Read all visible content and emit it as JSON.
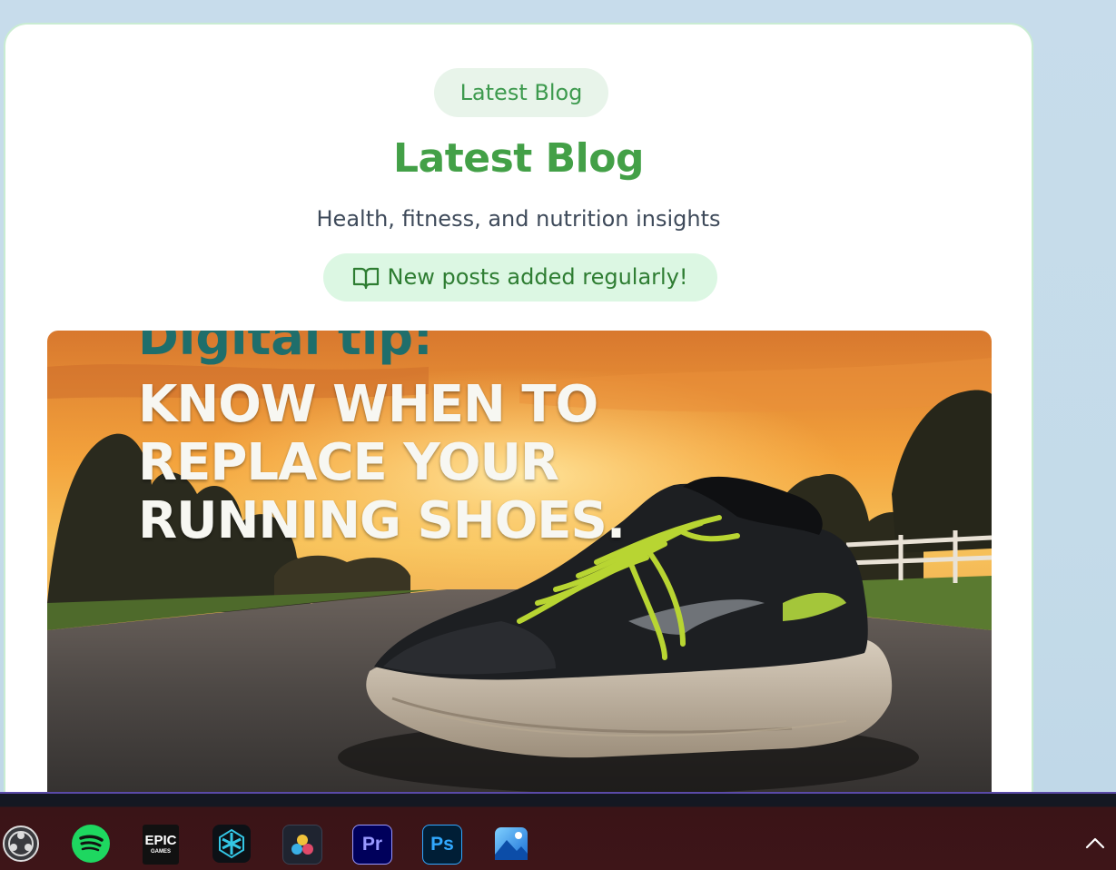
{
  "blog": {
    "badge_label": "Latest Blog",
    "heading": "Latest Blog",
    "subheading": "Health, fitness, and nutrition insights",
    "notice": "New posts added regularly!",
    "notice_icon": "book-open-icon"
  },
  "featured_post": {
    "image_caption_top": "Digital tip:",
    "image_lines": [
      "KNOW WHEN TO",
      "REPLACE YOUR",
      "RUNNING SHOES."
    ]
  },
  "taskbar": {
    "apps": [
      {
        "icon": "obs-icon"
      },
      {
        "icon": "spotify-icon"
      },
      {
        "icon": "epic-games-icon",
        "label": "EPIC",
        "sublabel": "GAMES"
      },
      {
        "icon": "app-blue-icon"
      },
      {
        "icon": "davinci-resolve-icon"
      },
      {
        "icon": "premiere-pro-icon",
        "label": "Pr"
      },
      {
        "icon": "photoshop-icon",
        "label": "Ps"
      },
      {
        "icon": "photos-icon"
      }
    ],
    "tray_icon": "chevron-up-icon"
  },
  "colors": {
    "accent": "#43a047",
    "pill_bg": "#e8f4ea",
    "notice_bg": "#dcf7e3",
    "taskbar_bg": "#3e1518"
  }
}
